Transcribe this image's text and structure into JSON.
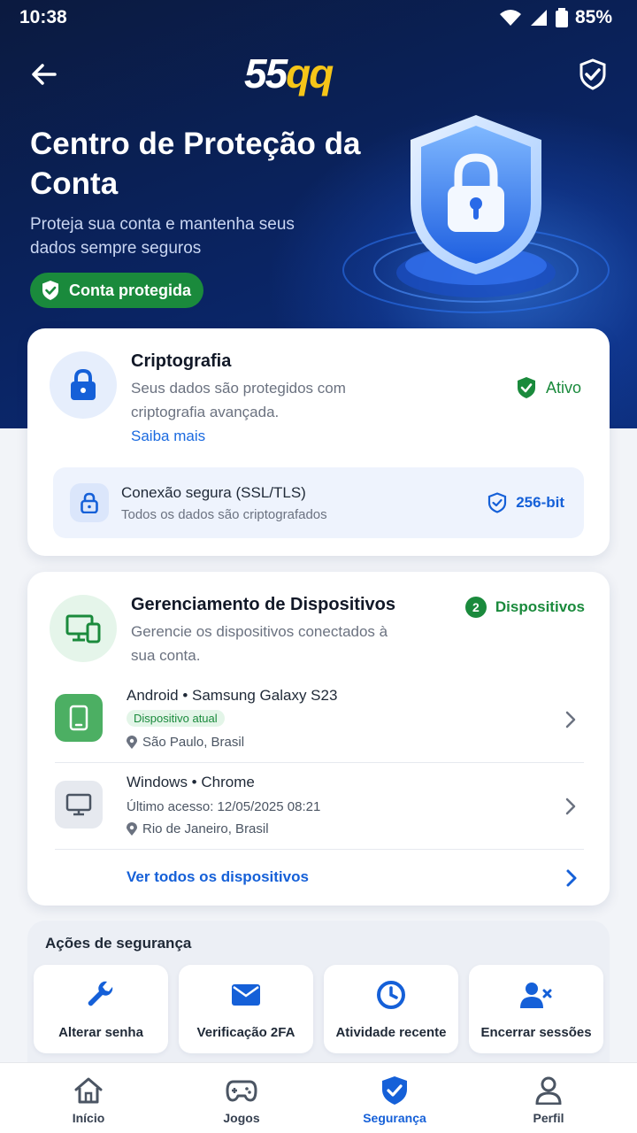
{
  "status_bar": {
    "time": "10:38",
    "battery": "85%"
  },
  "header": {
    "logo_part1": "55",
    "logo_part2": "qq"
  },
  "hero": {
    "title": "Centro de Proteção da Conta",
    "subtitle": "Proteja sua conta e mantenha seus dados sempre seguros",
    "badge": "Conta protegida"
  },
  "crypto_card": {
    "title": "Criptografia",
    "description": "Seus dados são protegidos com criptografia avançada.",
    "link": "Saiba mais",
    "status": "Ativo",
    "ssl": {
      "title": "Conexão segura (SSL/TLS)",
      "subtitle": "Todos os dados são criptografados",
      "strength": "256-bit"
    }
  },
  "devices_card": {
    "title": "Gerenciamento de Dispositivos",
    "description": "Gerencie os dispositivos conectados à sua conta.",
    "count": "2",
    "count_label": "Dispositivos",
    "devices": [
      {
        "name": "Android • Samsung Galaxy S23",
        "tag": "Dispositivo atual",
        "location": "São Paulo, Brasil"
      },
      {
        "name": "Windows • Chrome",
        "last_access": "Último acesso: 12/05/2025 08:21",
        "location": "Rio de Janeiro, Brasil"
      }
    ],
    "see_all": "Ver todos os dispositivos"
  },
  "actions": {
    "title": "Ações de segurança",
    "items": [
      {
        "label": "Alterar senha",
        "icon": "wrench-icon"
      },
      {
        "label": "Verificação 2FA",
        "icon": "envelope-icon"
      },
      {
        "label": "Atividade recente",
        "icon": "clock-icon"
      },
      {
        "label": "Encerrar sessões",
        "icon": "user-remove-icon"
      }
    ]
  },
  "bottom_nav": {
    "items": [
      {
        "label": "Início",
        "icon": "home-icon"
      },
      {
        "label": "Jogos",
        "icon": "gamepad-icon"
      },
      {
        "label": "Segurança",
        "icon": "shield-check-icon",
        "active": true
      },
      {
        "label": "Perfil",
        "icon": "user-icon"
      }
    ]
  },
  "colors": {
    "primary": "#1560d8",
    "success": "#1a8a3c",
    "brand_yellow": "#f5c518",
    "hero_bg": "#0a2463"
  }
}
